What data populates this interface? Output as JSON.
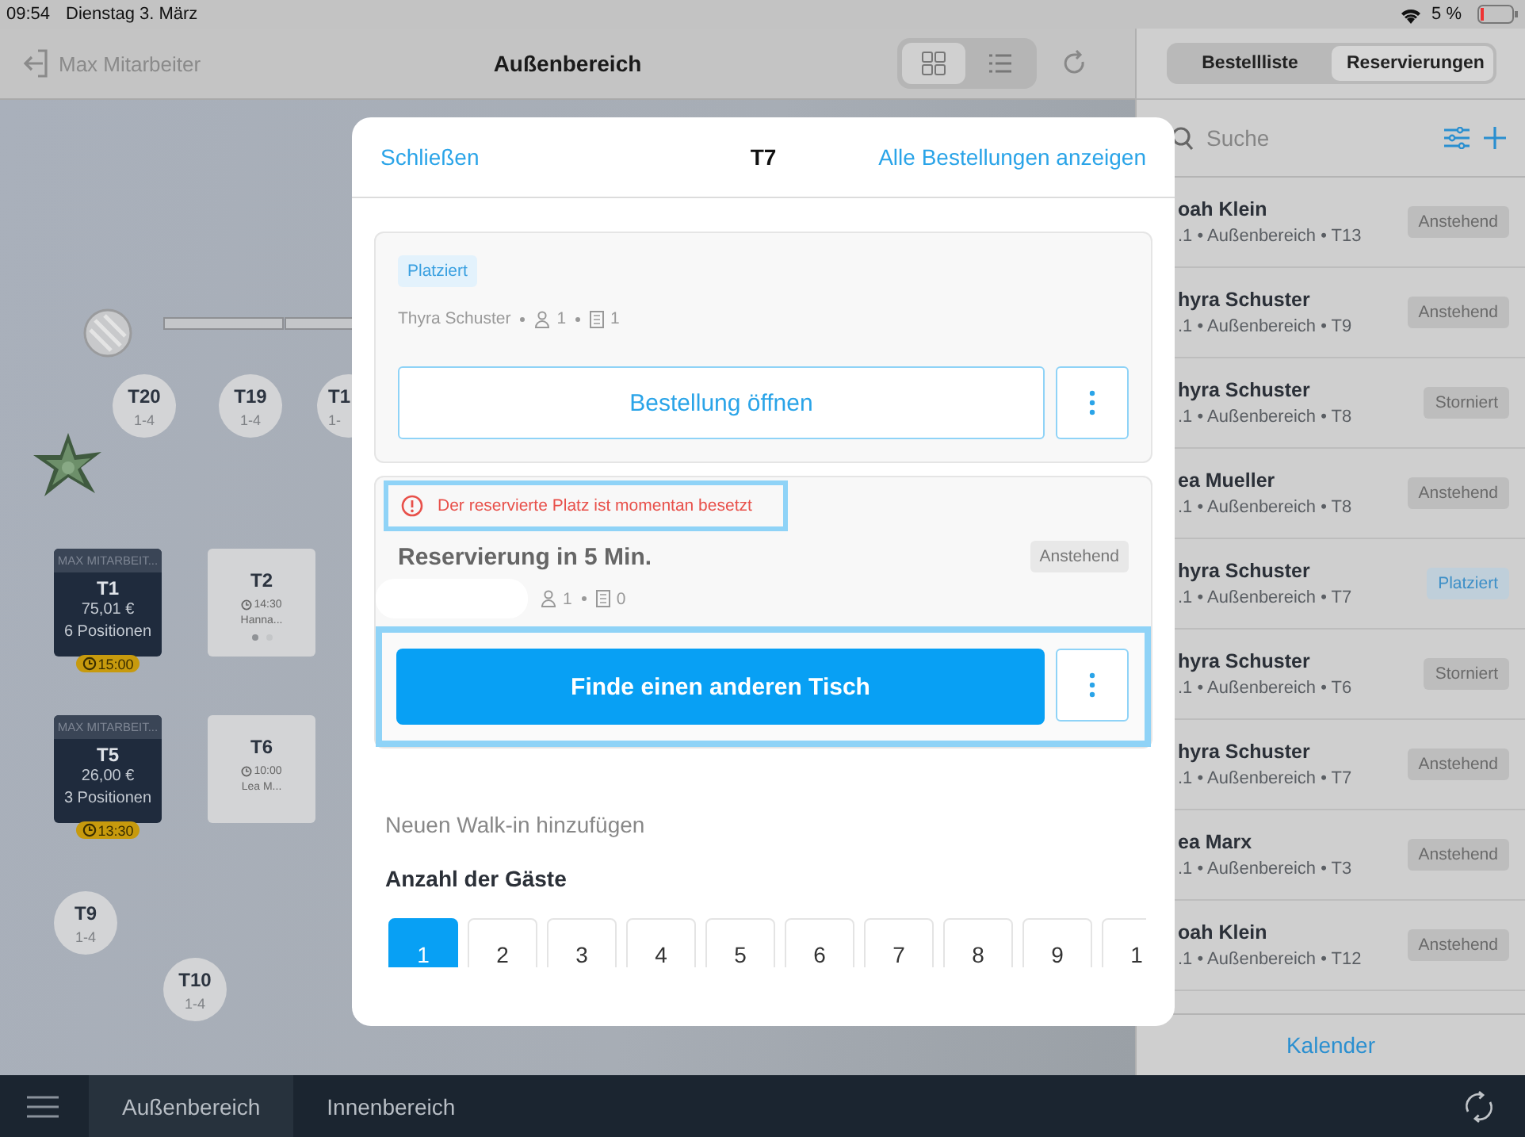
{
  "status_bar": {
    "time": "09:54",
    "date": "Dienstag 3. März",
    "battery": "5 %"
  },
  "header": {
    "user": "Max Mitarbeiter",
    "title": "Außenbereich",
    "view_modes": [
      {
        "kind": "grid",
        "selected": true
      },
      {
        "kind": "list",
        "selected": false
      }
    ]
  },
  "floor": {
    "tables": [
      {
        "kind": "round",
        "label": "T20",
        "capacity": "1-4"
      },
      {
        "kind": "round",
        "label": "T19",
        "capacity": "1-4"
      },
      {
        "kind": "round",
        "label": "T1",
        "capacity": "1-"
      },
      {
        "kind": "occupied",
        "waiter": "MAX MITARBEIT...",
        "label": "T1",
        "amount": "75,01 €",
        "positions": "6 Positionen",
        "time": "15:00"
      },
      {
        "kind": "reserved",
        "label": "T2",
        "time": "14:30",
        "guest": "Hanna...",
        "pages": [
          {
            "selected": true
          },
          {
            "selected": false
          }
        ]
      },
      {
        "kind": "occupied",
        "waiter": "MAX MITARBEIT...",
        "label": "T5",
        "amount": "26,00 €",
        "positions": "3 Positionen",
        "time": "13:30"
      },
      {
        "kind": "reserved",
        "label": "T6",
        "time": "10:00",
        "guest": "Lea M..."
      },
      {
        "kind": "round",
        "label": "T9",
        "capacity": "1-4"
      },
      {
        "kind": "round",
        "label": "T10",
        "capacity": "1-4"
      }
    ]
  },
  "side_panel": {
    "tabs": [
      {
        "label": "Bestellliste",
        "selected": false
      },
      {
        "label": "Reservierungen",
        "selected": true
      }
    ],
    "search": {
      "placeholder": "Suche"
    },
    "reservations": [
      {
        "name": "oah Klein",
        "details": ".1 • Außenbereich • T13",
        "status": "Anstehend",
        "kind": "pending"
      },
      {
        "name": "hyra Schuster",
        "details": ".1 • Außenbereich • T9",
        "status": "Anstehend",
        "kind": "pending"
      },
      {
        "name": "hyra Schuster",
        "details": ".1 • Außenbereich • T8",
        "status": "Storniert",
        "kind": "cancelled"
      },
      {
        "name": "ea Mueller",
        "details": ".1 • Außenbereich • T8",
        "status": "Anstehend",
        "kind": "pending"
      },
      {
        "name": "hyra Schuster",
        "details": ".1 • Außenbereich • T7",
        "status": "Platziert",
        "kind": "placed"
      },
      {
        "name": "hyra Schuster",
        "details": ".1 • Außenbereich • T6",
        "status": "Storniert",
        "kind": "cancelled"
      },
      {
        "name": "hyra Schuster",
        "details": ".1 • Außenbereich • T7",
        "status": "Anstehend",
        "kind": "pending"
      },
      {
        "name": "ea Marx",
        "details": ".1 • Außenbereich • T3",
        "status": "Anstehend",
        "kind": "pending"
      },
      {
        "name": "oah Klein",
        "details": ".1 • Außenbereich • T12",
        "status": "Anstehend",
        "kind": "pending"
      }
    ],
    "footer": "Kalender"
  },
  "modal": {
    "close": "Schließen",
    "title": "T7",
    "show_all": "Alle Bestellungen anzeigen",
    "order": {
      "badge": "Platziert",
      "guest": "Thyra Schuster",
      "guests": "1",
      "items": "1",
      "button": "Bestellung öffnen"
    },
    "reservation": {
      "warning": "Der reservierte Platz ist momentan besetzt",
      "title": "Reservierung in 5 Min.",
      "status": "Anstehend",
      "guests": "1",
      "items": "0",
      "button": "Finde einen anderen Tisch"
    },
    "walk_in": {
      "heading": "Neuen Walk-in hinzufügen",
      "label": "Anzahl der Gäste",
      "counts": [
        {
          "label": "1",
          "selected": true
        },
        {
          "label": "2",
          "selected": false
        },
        {
          "label": "3",
          "selected": false
        },
        {
          "label": "4",
          "selected": false
        },
        {
          "label": "5",
          "selected": false
        },
        {
          "label": "6",
          "selected": false
        },
        {
          "label": "7",
          "selected": false
        },
        {
          "label": "8",
          "selected": false
        },
        {
          "label": "9",
          "selected": false
        },
        {
          "label": "1",
          "selected": false
        }
      ]
    }
  },
  "bottom_bar": {
    "tabs": [
      {
        "label": "Außenbereich",
        "selected": true
      },
      {
        "label": "Innenbereich",
        "selected": false
      }
    ]
  }
}
